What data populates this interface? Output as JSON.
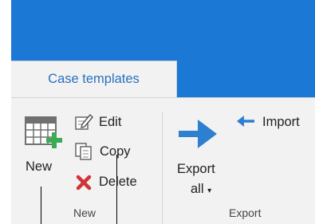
{
  "tab": {
    "label": "Case templates"
  },
  "new_group": {
    "label": "New",
    "new_button": {
      "label": "New"
    },
    "edit_button": {
      "label": "Edit"
    },
    "copy_button": {
      "label": "Copy"
    },
    "delete_button": {
      "label": "Delete"
    }
  },
  "export_group": {
    "label": "Export",
    "export_all_button": {
      "line1": "Export",
      "line2": "all",
      "caret": "▾"
    },
    "import_button": {
      "label": "Import"
    }
  },
  "colors": {
    "header_blue": "#1b78d4",
    "ribbon_bg": "#f2f2f2",
    "tab_text": "#2a72bd",
    "arrow_blue": "#2d7fd0",
    "plus_green": "#3aaa55",
    "delete_red": "#d13438"
  }
}
